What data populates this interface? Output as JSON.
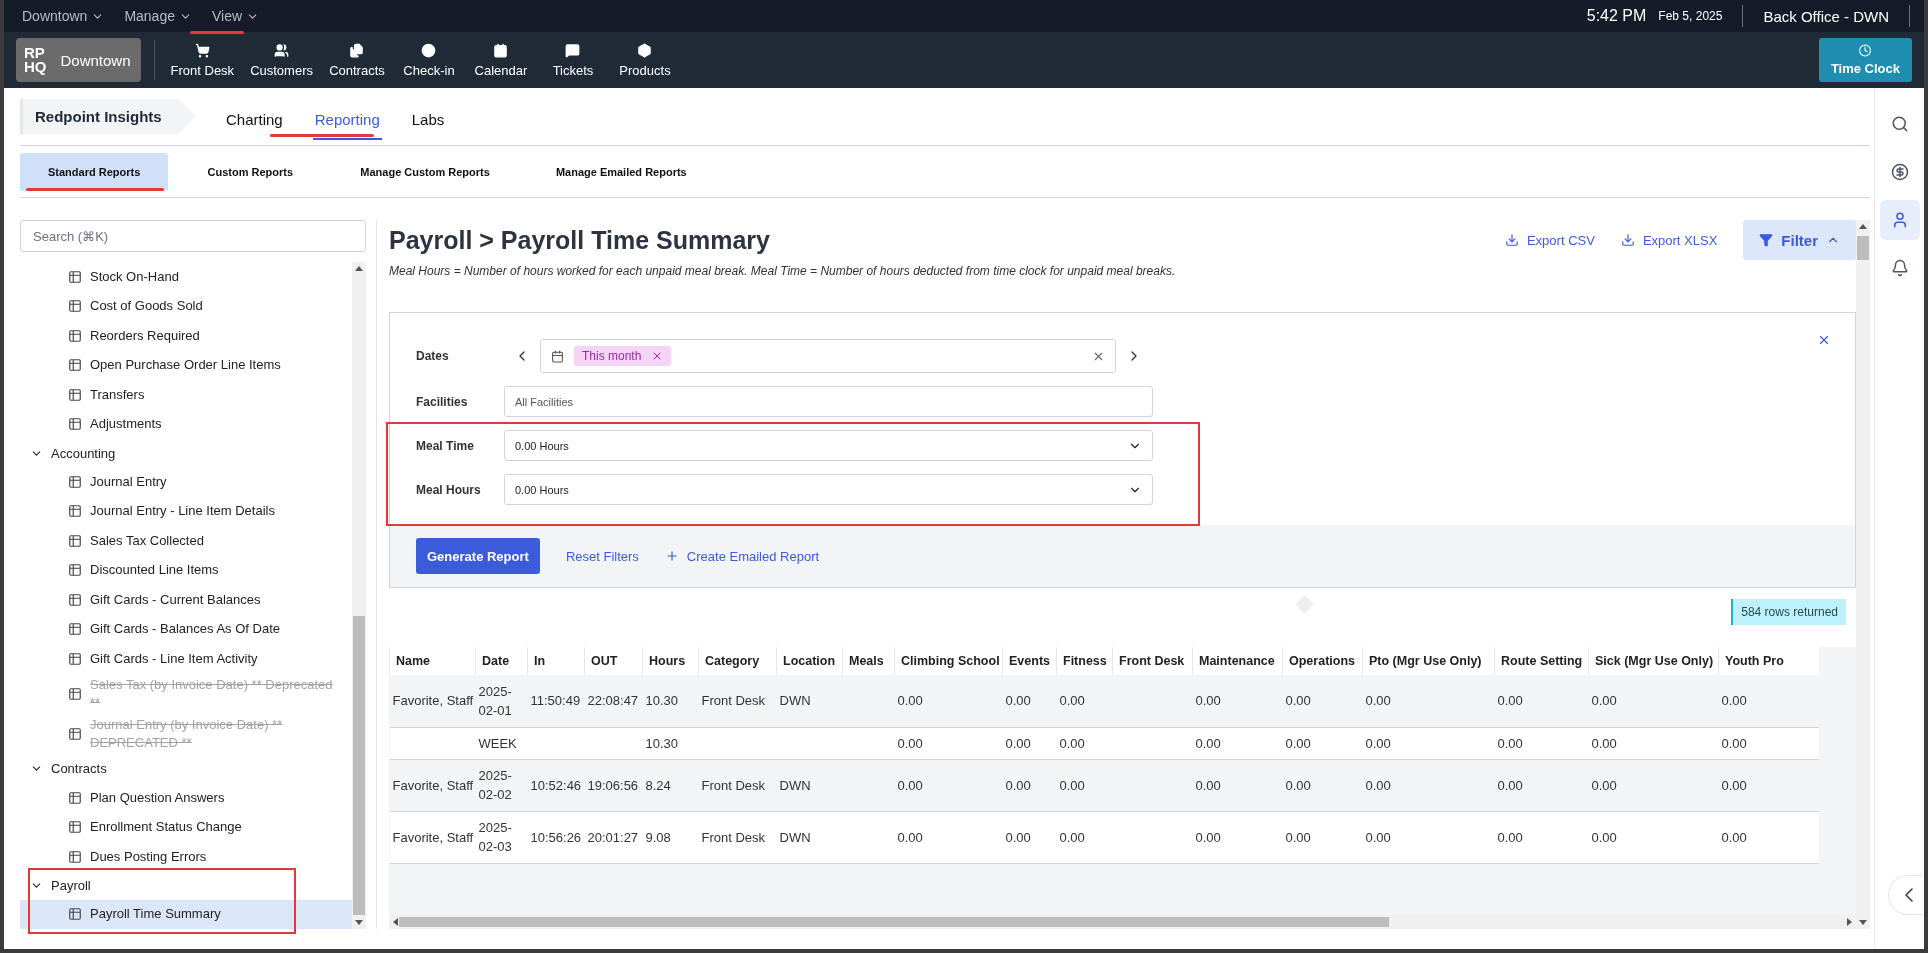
{
  "top_menu": [
    {
      "label": "Downtown"
    },
    {
      "label": "Manage"
    },
    {
      "label": "View"
    }
  ],
  "clock": {
    "time": "5:42 PM",
    "date": "Feb 5, 2025"
  },
  "location": "Back Office - DWN",
  "brand": {
    "logo_top": "RP",
    "logo_bottom": "HQ",
    "name": "Downtown"
  },
  "nav": [
    {
      "label": "Front Desk"
    },
    {
      "label": "Customers"
    },
    {
      "label": "Contracts"
    },
    {
      "label": "Check-in"
    },
    {
      "label": "Calendar"
    },
    {
      "label": "Tickets"
    },
    {
      "label": "Products"
    }
  ],
  "time_clock": "Time Clock",
  "insights": {
    "title": "Redpoint Insights",
    "tabs": [
      {
        "label": "Charting",
        "selected": false
      },
      {
        "label": "Reporting",
        "selected": true
      },
      {
        "label": "Labs",
        "selected": false
      }
    ]
  },
  "report_tabs": [
    {
      "label": "Standard Reports",
      "selected": true
    },
    {
      "label": "Custom Reports",
      "selected": false
    },
    {
      "label": "Manage Custom Reports",
      "selected": false
    },
    {
      "label": "Manage Emailed Reports",
      "selected": false
    }
  ],
  "search": {
    "placeholder": "Search (⌘K)"
  },
  "report_tree": [
    {
      "items": [
        {
          "label": "Stock On-Hand",
          "deprecated": false,
          "selected": false
        },
        {
          "label": "Cost of Goods Sold",
          "deprecated": false,
          "selected": false
        },
        {
          "label": "Reorders Required",
          "deprecated": false,
          "selected": false
        },
        {
          "label": "Open Purchase Order Line Items",
          "deprecated": false,
          "selected": false
        },
        {
          "label": "Transfers",
          "deprecated": false,
          "selected": false
        },
        {
          "label": "Adjustments",
          "deprecated": false,
          "selected": false
        }
      ]
    },
    {
      "label": "Accounting",
      "expanded": true,
      "items": [
        {
          "label": "Journal Entry",
          "deprecated": false,
          "selected": false
        },
        {
          "label": "Journal Entry - Line Item Details",
          "deprecated": false,
          "selected": false
        },
        {
          "label": "Sales Tax Collected",
          "deprecated": false,
          "selected": false
        },
        {
          "label": "Discounted Line Items",
          "deprecated": false,
          "selected": false
        },
        {
          "label": "Gift Cards - Current Balances",
          "deprecated": false,
          "selected": false
        },
        {
          "label": "Gift Cards - Balances As Of Date",
          "deprecated": false,
          "selected": false
        },
        {
          "label": "Gift Cards - Line Item Activity",
          "deprecated": false,
          "selected": false
        },
        {
          "label": "Sales Tax (by Invoice Date) ** Deprecated **",
          "deprecated": true,
          "selected": false
        },
        {
          "label": "Journal Entry (by Invoice Date) ** DEPRECATED **",
          "deprecated": true,
          "selected": false
        }
      ]
    },
    {
      "label": "Contracts",
      "expanded": true,
      "items": [
        {
          "label": "Plan Question Answers",
          "deprecated": false,
          "selected": false
        },
        {
          "label": "Enrollment Status Change",
          "deprecated": false,
          "selected": false
        },
        {
          "label": "Dues Posting Errors",
          "deprecated": false,
          "selected": false
        }
      ]
    },
    {
      "label": "Payroll",
      "expanded": true,
      "items": [
        {
          "label": "Payroll Time Summary",
          "deprecated": false,
          "selected": true
        }
      ]
    }
  ],
  "page": {
    "title": "Payroll > Payroll Time Summary",
    "note": "Meal Hours = Number of hours worked for each unpaid meal break. Meal Time = Number of hours deducted from time clock for unpaid meal breaks.",
    "actions": [
      {
        "label": "Export CSV"
      },
      {
        "label": "Export XLSX"
      }
    ],
    "filter_button": {
      "label": "Filter",
      "expanded": true
    }
  },
  "filters": {
    "dates": {
      "label": "Dates",
      "chip": "This month"
    },
    "fields": [
      {
        "label": "Facilities",
        "kind": "text",
        "placeholder": "All Facilities"
      },
      {
        "label": "Meal Time",
        "kind": "select",
        "value": "0.00 Hours"
      },
      {
        "label": "Meal Hours",
        "kind": "select",
        "value": "0.00 Hours"
      }
    ],
    "buttons": {
      "generate": "Generate Report",
      "reset": "Reset Filters",
      "emailed": "Create Emailed Report"
    }
  },
  "result_count": "584 rows returned",
  "table": {
    "columns": [
      "Name",
      "Date",
      "In",
      "OUT",
      "Hours",
      "Category",
      "Location",
      "Meals",
      "Climbing School",
      "Events",
      "Fitness",
      "Front Desk",
      "Maintenance",
      "Operations",
      "Pto (Mgr Use Only)",
      "Route Setting",
      "Sick (Mgr Use Only)",
      "Youth Pro"
    ],
    "rows": [
      {
        "cells": [
          "Favorite, Staff",
          "2025-02-01",
          "11:50:49",
          "22:08:47",
          "10.30",
          "Front Desk",
          "DWN",
          null,
          "0.00",
          "0.00",
          "0.00",
          null,
          "0.00",
          "0.00",
          "0.00",
          "0.00",
          "0.00",
          "0.00"
        ]
      },
      {
        "cells": [
          null,
          "WEEK",
          null,
          null,
          "10.30",
          null,
          null,
          null,
          "0.00",
          "0.00",
          "0.00",
          null,
          "0.00",
          "0.00",
          "0.00",
          "0.00",
          "0.00",
          "0.00"
        ]
      },
      {
        "cells": [
          "Favorite, Staff",
          "2025-02-02",
          "10:52:46",
          "19:06:56",
          "8.24",
          "Front Desk",
          "DWN",
          null,
          "0.00",
          "0.00",
          "0.00",
          null,
          "0.00",
          "0.00",
          "0.00",
          "0.00",
          "0.00",
          "0.00"
        ]
      },
      {
        "cells": [
          "Favorite, Staff",
          "2025-02-03",
          "10:56:26",
          "20:01:27",
          "9.08",
          "Front Desk",
          "DWN",
          null,
          "0.00",
          "0.00",
          "0.00",
          null,
          "0.00",
          "0.00",
          "0.00",
          "0.00",
          "0.00",
          "0.00"
        ]
      }
    ]
  }
}
